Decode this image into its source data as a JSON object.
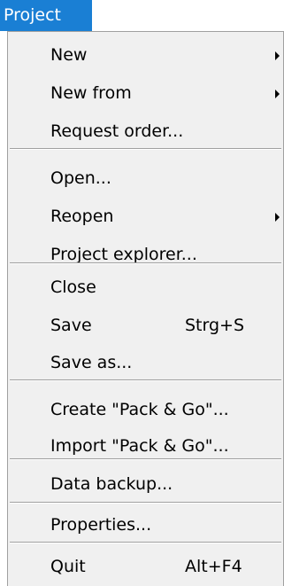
{
  "menubar": {
    "title": "Project"
  },
  "menu": {
    "new": "New",
    "new_from": "New from",
    "request_order": "Request order...",
    "open": "Open...",
    "reopen": "Reopen",
    "project_explorer": "Project explorer...",
    "close": "Close",
    "save": "Save",
    "save_shortcut": "Strg+S",
    "save_as": "Save as...",
    "create_pack_go": "Create \"Pack & Go\"...",
    "import_pack_go": "Import \"Pack & Go\"...",
    "data_backup": "Data backup...",
    "properties": "Properties...",
    "quit": "Quit",
    "quit_shortcut": "Alt+F4"
  }
}
